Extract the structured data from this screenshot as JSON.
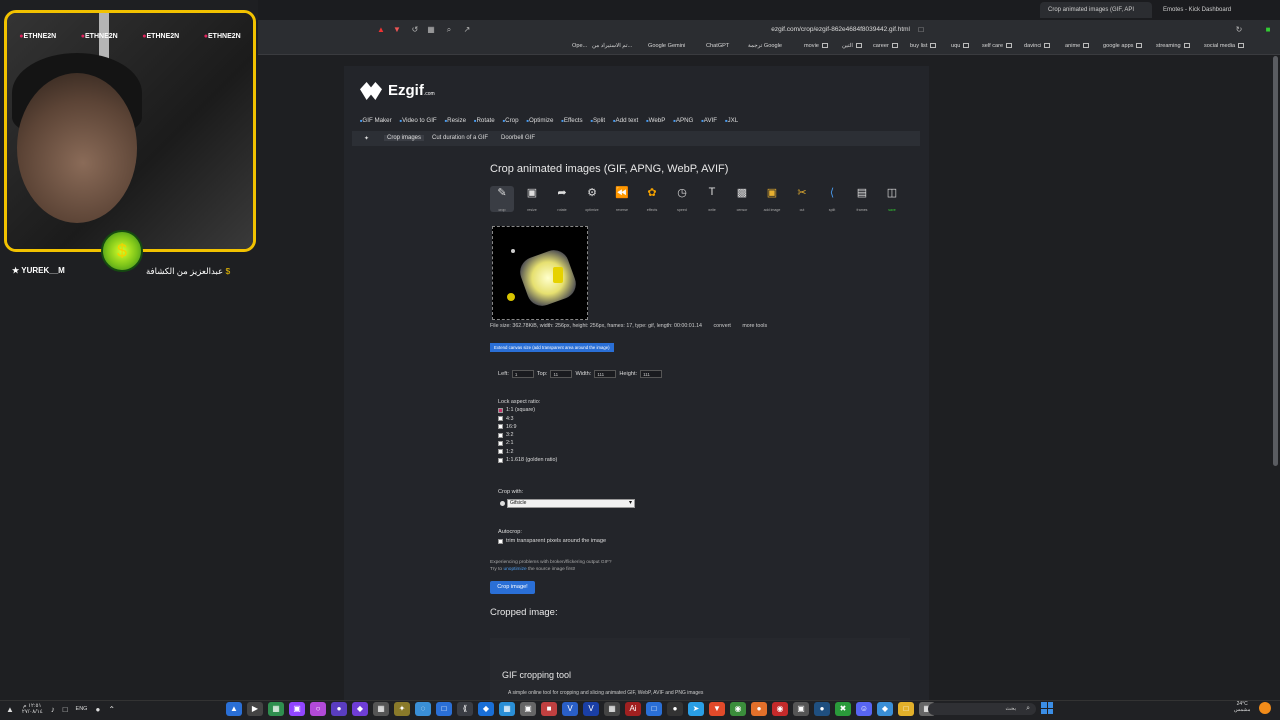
{
  "browser": {
    "tabs": [
      "Crop animated images (GIF, API",
      "Emotes - Kick Dashboard"
    ],
    "url": "ezgif.com/crop/ezgif-862e4684f8039442.gif.html",
    "bookmarks": [
      "Ope...",
      "تم الاستيراد من...",
      "Google Gemini",
      "ChatGPT",
      "ترجمة Google",
      "movie",
      "التين",
      "career",
      "buy list",
      "uqu",
      "self care",
      "davinci",
      "anime",
      "google apps",
      "streaming",
      "social media"
    ]
  },
  "overlay": {
    "banner": [
      "ETHNE2N",
      "ETHNE2N",
      "ETHNE2N",
      "ETHNE2N"
    ],
    "user_left": "YUREK__M",
    "user_right": "عبدالعزيز من الكشافة"
  },
  "site": {
    "logo": "Ezgif",
    "logo_suffix": ".com",
    "nav": [
      "GIF Maker",
      "Video to GIF",
      "Resize",
      "Rotate",
      "Crop",
      "Optimize",
      "Effects",
      "Split",
      "Add text",
      "WebP",
      "APNG",
      "AVIF",
      "JXL"
    ],
    "subnav": [
      "Crop images",
      "Cut duration of a GIF",
      "Doorbell GIF"
    ],
    "title": "Crop animated images (GIF, APNG, WebP, AVIF)",
    "tools": [
      {
        "label": "crop",
        "icon": "crop-icon"
      },
      {
        "label": "resize",
        "icon": "resize-icon"
      },
      {
        "label": "rotate",
        "icon": "rotate-icon"
      },
      {
        "label": "optimize",
        "icon": "optimize-icon"
      },
      {
        "label": "reverse",
        "icon": "reverse-icon"
      },
      {
        "label": "effects",
        "icon": "effects-icon"
      },
      {
        "label": "speed",
        "icon": "speed-icon"
      },
      {
        "label": "write",
        "icon": "write-icon"
      },
      {
        "label": "censor",
        "icon": "censor-icon"
      },
      {
        "label": "add image",
        "icon": "add-image-icon"
      },
      {
        "label": "cut",
        "icon": "cut-icon"
      },
      {
        "label": "split",
        "icon": "split-icon"
      },
      {
        "label": "frames",
        "icon": "frames-icon"
      },
      {
        "label": "save",
        "icon": "save-icon"
      }
    ],
    "file_info": "File size: 362.78KiB, width: 256px, height: 256px, frames: 17, type: gif, length: 00:00:01.14",
    "convert_label": "convert",
    "more_tools_label": "more tools",
    "extend_label": "Extend canvas size (add transparent area around the image)",
    "fields": {
      "left_label": "Left:",
      "left_value": "1",
      "top_label": "Top:",
      "top_value": "11",
      "width_label": "Width:",
      "width_value": "111",
      "height_label": "Height:",
      "height_value": "111"
    },
    "lock_label": "Lock aspect ratio:",
    "aspect_options": [
      {
        "label": "1:1 (square)",
        "checked": true
      },
      {
        "label": "4:3",
        "checked": false
      },
      {
        "label": "16:9",
        "checked": false
      },
      {
        "label": "3:2",
        "checked": false
      },
      {
        "label": "2:1",
        "checked": false
      },
      {
        "label": "1:2",
        "checked": false
      },
      {
        "label": "1:1.618 (golden ratio)",
        "checked": false
      }
    ],
    "crop_with_label": "Crop with:",
    "crop_with_value": "Gifsicle",
    "autocrop_label": "Autocrop:",
    "autocrop_option": "trim transparent pixels around the image",
    "notice_line1": "Experiencing problems with broken/flickering output GIF?",
    "notice_try": "Try to",
    "notice_link": "unoptimize",
    "notice_rest": "the source image first!",
    "crop_button": "Crop image!",
    "cropped_heading": "Cropped image:",
    "tool_heading": "GIF cropping tool",
    "tool_desc": "A simple online tool for cropping and slicing animated GIF, WebP, AVIF and PNG images"
  },
  "taskbar": {
    "time": "١٢:٥١ م",
    "date": "٢٧/٠٨/١٤",
    "lang": "ENG",
    "search_placeholder": "بحث",
    "weather_temp": "24°C",
    "weather_desc": "مشمس"
  }
}
